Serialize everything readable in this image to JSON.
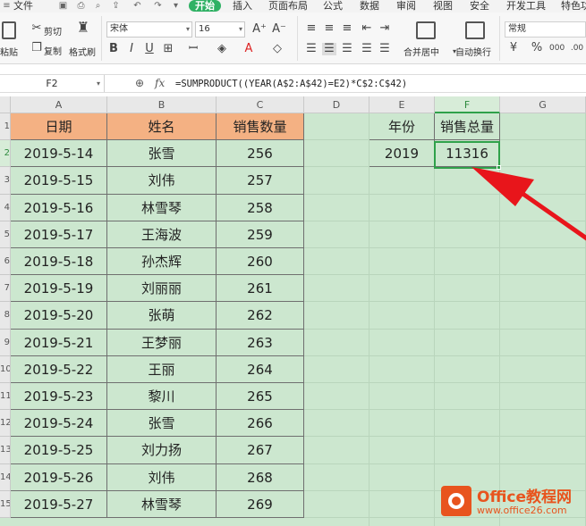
{
  "menu": {
    "file": "文件",
    "tabs": [
      "开始",
      "插入",
      "页面布局",
      "公式",
      "数据",
      "审阅",
      "视图",
      "安全",
      "开发工具",
      "特色功"
    ]
  },
  "ribbon": {
    "paste": "粘贴",
    "cut": "剪切",
    "copy": "复制",
    "format_painter": "格式刷",
    "font_name": "宋体",
    "font_size": "16",
    "merge_center": "合并居中",
    "wrap_text": "自动换行",
    "number_format": "常规"
  },
  "formula_bar": {
    "name_box": "F2",
    "fx": "fx",
    "formula": "=SUMPRODUCT((YEAR(A$2:A$42)=E2)*C$2:C$42)"
  },
  "columns": [
    "A",
    "B",
    "C",
    "D",
    "E",
    "F",
    "G"
  ],
  "rows": [
    "1",
    "2",
    "3",
    "4",
    "5",
    "6",
    "7",
    "8",
    "9",
    "10",
    "11",
    "12",
    "13",
    "14",
    "15"
  ],
  "table": {
    "headers": [
      "日期",
      "姓名",
      "销售数量"
    ],
    "rows": [
      [
        "2019-5-14",
        "张雪",
        "256"
      ],
      [
        "2019-5-15",
        "刘伟",
        "257"
      ],
      [
        "2019-5-16",
        "林雪琴",
        "258"
      ],
      [
        "2019-5-17",
        "王海波",
        "259"
      ],
      [
        "2019-5-18",
        "孙杰辉",
        "260"
      ],
      [
        "2019-5-19",
        "刘丽丽",
        "261"
      ],
      [
        "2019-5-20",
        "张萌",
        "262"
      ],
      [
        "2019-5-21",
        "王梦丽",
        "263"
      ],
      [
        "2019-5-22",
        "王丽",
        "264"
      ],
      [
        "2019-5-23",
        "黎川",
        "265"
      ],
      [
        "2019-5-24",
        "张雪",
        "266"
      ],
      [
        "2019-5-25",
        "刘力扬",
        "267"
      ],
      [
        "2019-5-26",
        "刘伟",
        "268"
      ],
      [
        "2019-5-27",
        "林雪琴",
        "269"
      ]
    ]
  },
  "summary": {
    "year_header": "年份",
    "total_header": "销售总量",
    "year": "2019",
    "total": "11316"
  },
  "watermark": {
    "title": "Office教程网",
    "url": "www.office26.com"
  },
  "colors": {
    "accent_green": "#2fa14a",
    "header_fill": "#f4b183",
    "sheet_background": "#cce7cf",
    "arrow_red": "#e8151b",
    "watermark_orange": "#e8541e"
  }
}
